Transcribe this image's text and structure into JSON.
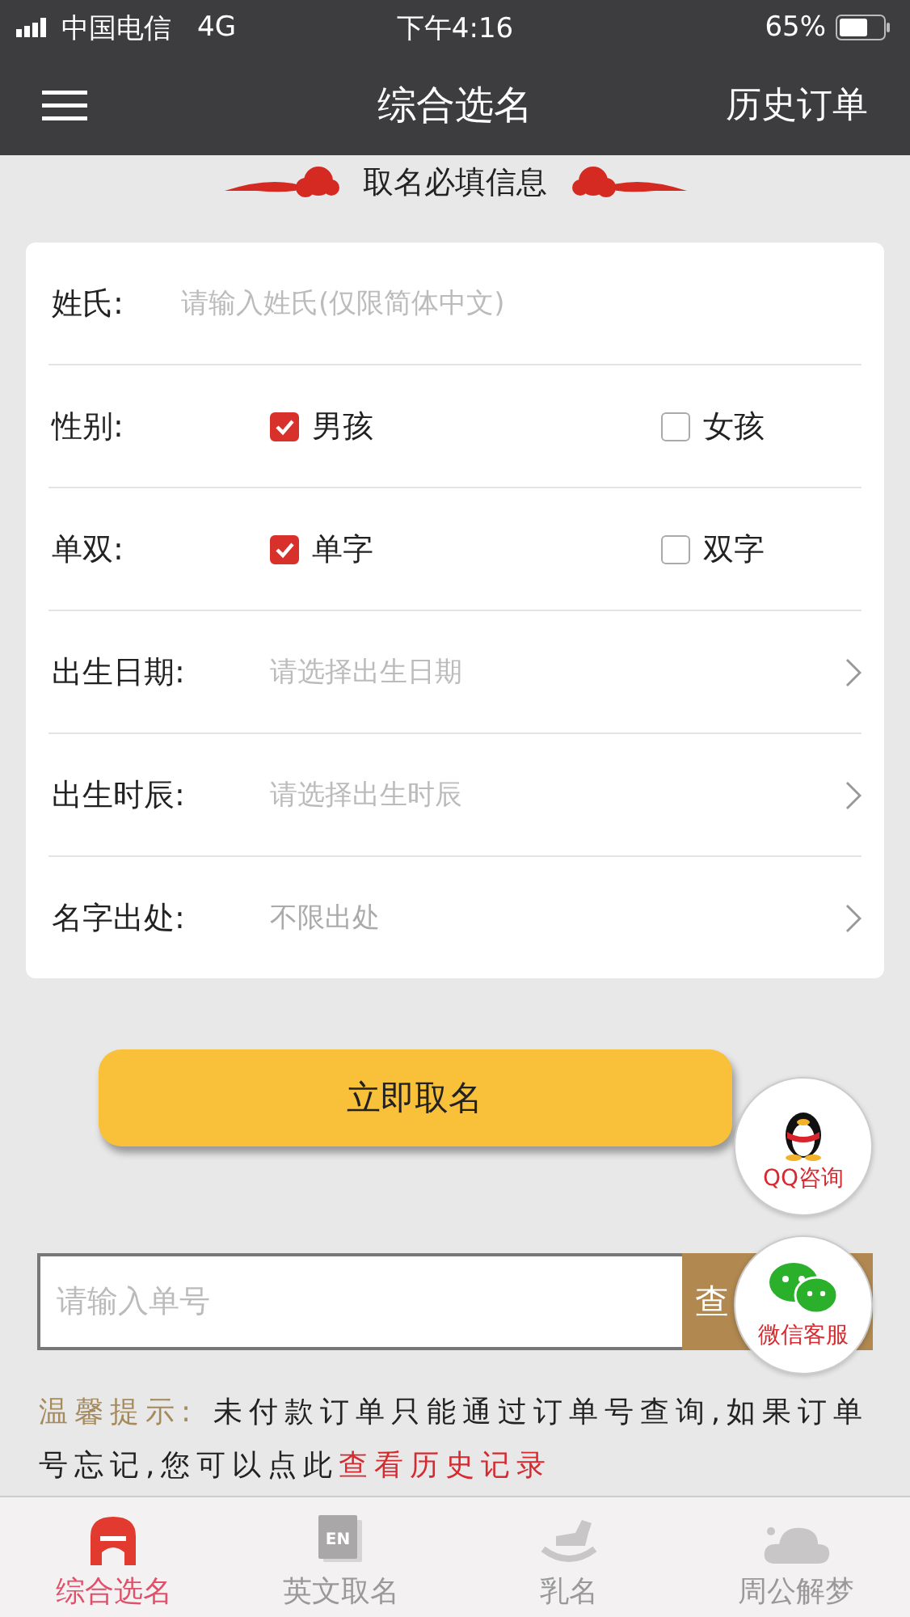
{
  "status_bar": {
    "carrier": "中国电信",
    "network": "4G",
    "time": "下午4:16",
    "battery": "65%"
  },
  "nav": {
    "title": "综合选名",
    "action": "历史订单"
  },
  "section_title": "取名必填信息",
  "form": [
    {
      "kind": "input",
      "label": "姓氏:",
      "placeholder": "请输入姓氏(仅限简体中文)"
    },
    {
      "kind": "choice",
      "label": "性别:",
      "options": [
        {
          "label": "男孩",
          "checked": true
        },
        {
          "label": "女孩",
          "checked": false
        }
      ]
    },
    {
      "kind": "choice",
      "label": "单双:",
      "options": [
        {
          "label": "单字",
          "checked": true
        },
        {
          "label": "双字",
          "checked": false
        }
      ]
    },
    {
      "kind": "select",
      "label": "出生日期:",
      "placeholder": "请选择出生日期"
    },
    {
      "kind": "select",
      "label": "出生时辰:",
      "placeholder": "请选择出生时辰"
    },
    {
      "kind": "select",
      "label": "名字出处:",
      "value": "不限出处"
    }
  ],
  "submit": "立即取名",
  "order_search": {
    "placeholder": "请输入单号",
    "button": "查"
  },
  "tip": {
    "label": "温馨提示:",
    "text": "未付款订单只能通过订单号查询,如果订单号忘记,您可以点此",
    "link": "查看历史记录"
  },
  "floating": [
    {
      "kind": "qq",
      "label": "QQ咨询"
    },
    {
      "kind": "wechat",
      "label": "微信客服"
    }
  ],
  "tabs": [
    {
      "kind": "home",
      "label": "综合选名",
      "selected": true
    },
    {
      "kind": "en",
      "label": "英文取名",
      "icon_text": "EN",
      "selected": false
    },
    {
      "kind": "horse",
      "label": "乳名",
      "selected": false
    },
    {
      "kind": "cloud",
      "label": "周公解梦",
      "selected": false
    }
  ]
}
